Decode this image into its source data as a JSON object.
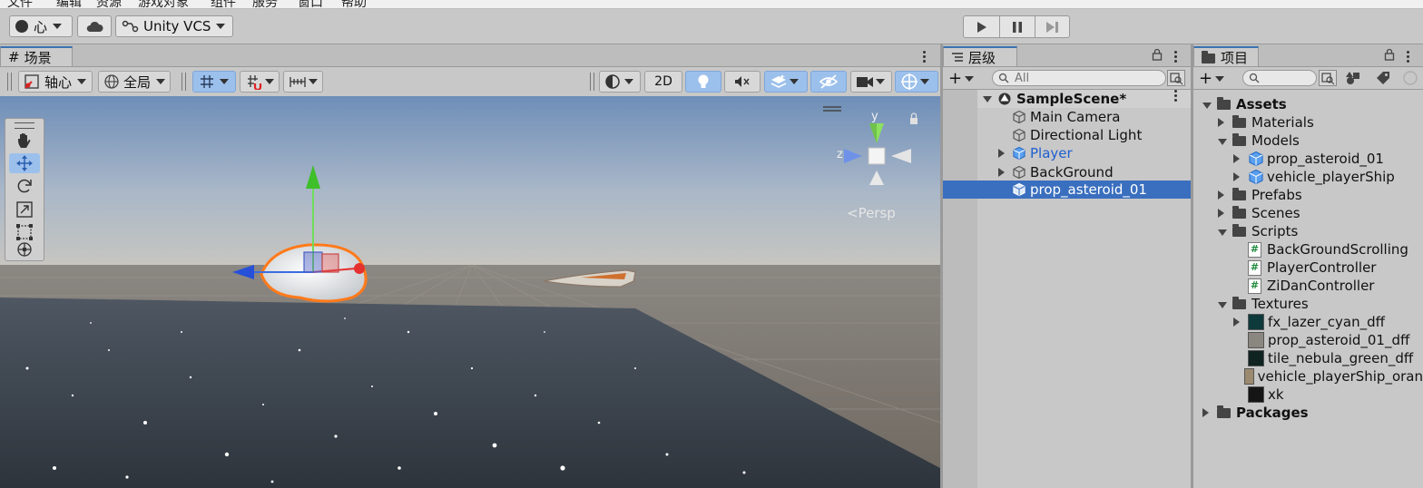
{
  "menubar": [
    "文件",
    "编辑",
    "资源",
    "游戏对象",
    "组件",
    "服务",
    "窗口",
    "帮助"
  ],
  "toolbar": {
    "account_label": "心",
    "vcs_label": "Unity VCS"
  },
  "scene": {
    "tab_label": "场景",
    "pivot_label": "轴心",
    "global_label": "全局",
    "mode_2d": "2D",
    "persp_label": "<Persp",
    "gizmo_axes": {
      "y": "y",
      "z": "z"
    }
  },
  "hierarchy": {
    "tab_label": "层级",
    "search_placeholder": "All",
    "scene_name": "SampleScene*",
    "items": [
      {
        "label": "Main Camera",
        "icon": "gameobject-icon",
        "expandable": false,
        "selected": false,
        "prefab": false
      },
      {
        "label": "Directional Light",
        "icon": "gameobject-icon",
        "expandable": false,
        "selected": false,
        "prefab": false
      },
      {
        "label": "Player",
        "icon": "prefab-icon",
        "expandable": true,
        "selected": false,
        "prefab": true
      },
      {
        "label": "BackGround",
        "icon": "gameobject-icon",
        "expandable": true,
        "selected": false,
        "prefab": false
      },
      {
        "label": "prop_asteroid_01",
        "icon": "model-icon",
        "expandable": false,
        "selected": true,
        "prefab": false
      }
    ]
  },
  "project": {
    "tab_label": "项目",
    "tree": [
      {
        "label": "Assets",
        "depth": 0,
        "type": "folder",
        "state": "open",
        "bold": true
      },
      {
        "label": "Materials",
        "depth": 1,
        "type": "folder",
        "state": "closed"
      },
      {
        "label": "Models",
        "depth": 1,
        "type": "folder",
        "state": "open"
      },
      {
        "label": "prop_asteroid_01",
        "depth": 2,
        "type": "model",
        "state": "closed"
      },
      {
        "label": "vehicle_playerShip",
        "depth": 2,
        "type": "model",
        "state": "closed"
      },
      {
        "label": "Prefabs",
        "depth": 1,
        "type": "folder",
        "state": "closed"
      },
      {
        "label": "Scenes",
        "depth": 1,
        "type": "folder",
        "state": "closed"
      },
      {
        "label": "Scripts",
        "depth": 1,
        "type": "folder",
        "state": "open"
      },
      {
        "label": "BackGroundScrolling",
        "depth": 2,
        "type": "script",
        "state": "none"
      },
      {
        "label": "PlayerController",
        "depth": 2,
        "type": "script",
        "state": "none"
      },
      {
        "label": "ZiDanController",
        "depth": 2,
        "type": "script",
        "state": "none"
      },
      {
        "label": "Textures",
        "depth": 1,
        "type": "folder",
        "state": "open"
      },
      {
        "label": "fx_lazer_cyan_dff",
        "depth": 2,
        "type": "texture",
        "state": "closed",
        "swatch": "#0e3a3c"
      },
      {
        "label": "prop_asteroid_01_dff",
        "depth": 2,
        "type": "texture",
        "state": "none",
        "swatch": "#8a8680"
      },
      {
        "label": "tile_nebula_green_dff",
        "depth": 2,
        "type": "texture",
        "state": "none",
        "swatch": "#0f2420"
      },
      {
        "label": "vehicle_playerShip_oran",
        "depth": 2,
        "type": "texture",
        "state": "none",
        "swatch": "#9c8a70"
      },
      {
        "label": "xk",
        "depth": 2,
        "type": "texture",
        "state": "none",
        "swatch": "#151515"
      },
      {
        "label": "Packages",
        "depth": 0,
        "type": "folder",
        "state": "closed",
        "bold": true
      }
    ]
  },
  "colors": {
    "selection": "#3a6fbf",
    "accent_tab": "#3a72b0",
    "prefab_text": "#1f5fcf"
  }
}
